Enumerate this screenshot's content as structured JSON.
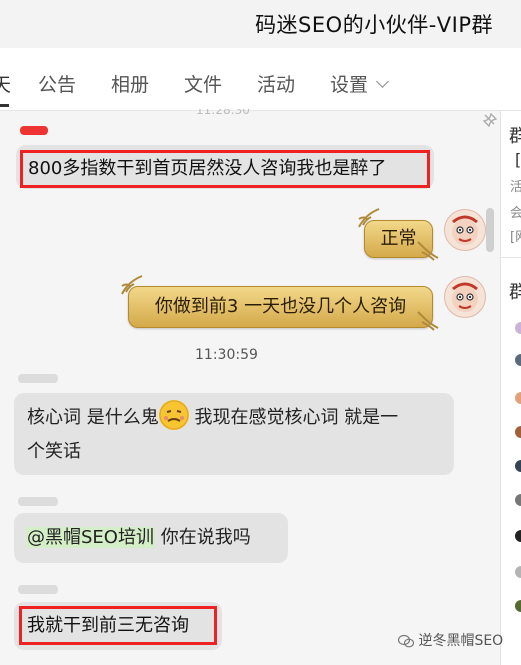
{
  "window": {
    "title": "码迷SEO的小伙伴-VIP群"
  },
  "tabs": [
    {
      "label": "天"
    },
    {
      "label": "公告"
    },
    {
      "label": "相册"
    },
    {
      "label": "文件"
    },
    {
      "label": "活动"
    },
    {
      "label": "设置"
    }
  ],
  "messages": {
    "m1": {
      "text": "800多指数干到首页居然没人咨询我也是醉了"
    },
    "m2": {
      "text": "正常"
    },
    "m3": {
      "text": "你做到前3 一天也没几个人咨询"
    },
    "timestamp": "11:30:59",
    "m4": {
      "line1_a": "核心词 是什么鬼",
      "line1_b": " 我现在感觉核心词 就是一",
      "line2": "个笑话"
    },
    "m5": {
      "mention": "@黑帽SEO培训",
      "text": " 你在说我吗"
    },
    "m6": {
      "text": "我就干到前三无咨询"
    }
  },
  "right_panel": {
    "fragments": [
      "群",
      "[",
      "活",
      "会",
      "[网",
      "群"
    ]
  },
  "watermark": "逆冬黑帽SEO",
  "colors": {
    "highlight_box": "#ee2222",
    "gold_bubble": "#e2bf68",
    "mention_bg": "#d4eec7"
  }
}
